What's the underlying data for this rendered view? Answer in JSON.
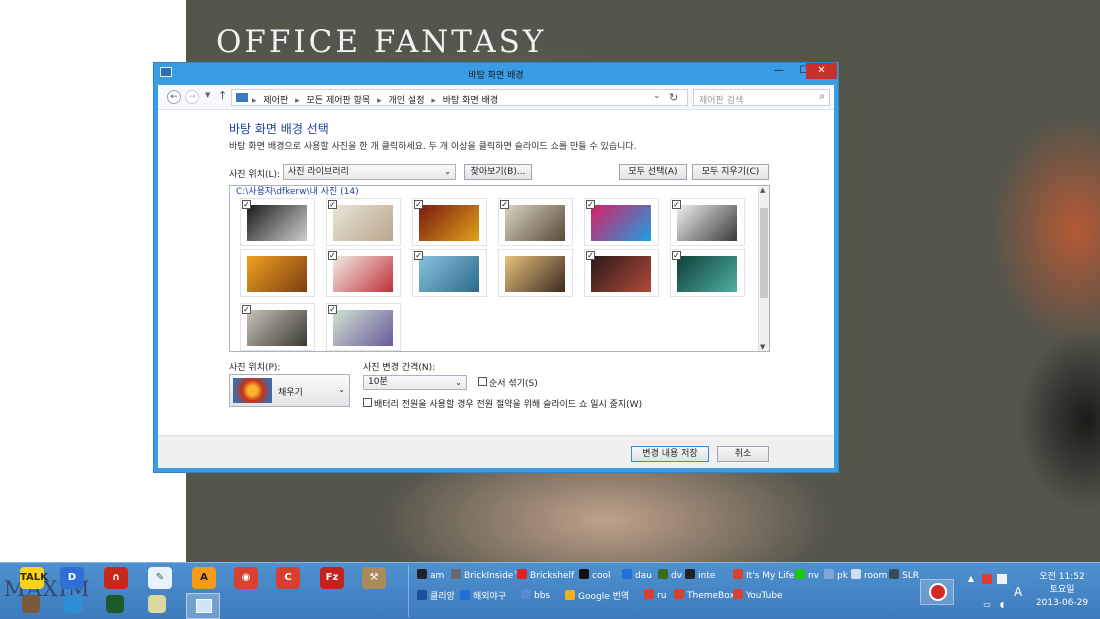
{
  "wallpaper": {
    "title": "OFFICE FANTASY"
  },
  "window": {
    "title": "바탕 화면 배경",
    "controls": {
      "minimize": "—",
      "maximize": "☐",
      "close": "✕"
    }
  },
  "address": {
    "crumbs": [
      "제어판",
      "모든 제어판 항목",
      "개인 설정",
      "바탕 화면 배경"
    ],
    "separator": "▸",
    "search_placeholder": "제어판 검색"
  },
  "page": {
    "heading": "바탕 화면 배경 선택",
    "description": "바탕 화면 배경으로 사용할 사진을 한 개 클릭하세요. 두 개 이상을 클릭하면 슬라이드 쇼를 만들 수 있습니다.",
    "location_label": "사진 위치(L):",
    "location_value": "사진 라이브러리",
    "browse": "찾아보기(B)...",
    "select_all": "모두 선택(A)",
    "clear_all": "모두 지우기(C)",
    "folder": "C:\\사용자\\dfkerw\\내 사진 (14)"
  },
  "photos": [
    {
      "checked": true,
      "colors": [
        "#1a1a1a",
        "#cfcfcf"
      ]
    },
    {
      "checked": true,
      "colors": [
        "#e9e4d8",
        "#b9a68c"
      ]
    },
    {
      "checked": true,
      "colors": [
        "#7a1a0e",
        "#e0a21d"
      ]
    },
    {
      "checked": true,
      "colors": [
        "#d9d3c2",
        "#5a4a3a"
      ]
    },
    {
      "checked": true,
      "colors": [
        "#d81e64",
        "#1ea0e0"
      ]
    },
    {
      "checked": true,
      "colors": [
        "#f0f0f0",
        "#3a3a3a"
      ]
    },
    {
      "checked": false,
      "colors": [
        "#f0a020",
        "#7b3e12"
      ]
    },
    {
      "checked": true,
      "colors": [
        "#f2ede6",
        "#c0303a"
      ]
    },
    {
      "checked": true,
      "colors": [
        "#86c3de",
        "#2c6a8a"
      ]
    },
    {
      "checked": false,
      "colors": [
        "#e7c07a",
        "#3b2c22"
      ]
    },
    {
      "checked": true,
      "colors": [
        "#2a1a18",
        "#b04a3a"
      ]
    },
    {
      "checked": true,
      "colors": [
        "#0f3f3a",
        "#4fb0a0"
      ]
    },
    {
      "checked": true,
      "colors": [
        "#c8c3b8",
        "#3a3a32"
      ]
    },
    {
      "checked": true,
      "colors": [
        "#cfe3d0",
        "#6a5a9a"
      ]
    }
  ],
  "options": {
    "position_label": "사진 위치(P):",
    "position_value": "채우기",
    "interval_label": "사진 변경 간격(N):",
    "interval_value": "10분",
    "shuffle_label": "순서 섞기(S)",
    "shuffle_checked": false,
    "battery_label": "배터리 전원을 사용할 경우 전원 절약을 위해 슬라이드 쇼 일시 중지(W)",
    "battery_checked": false
  },
  "footer": {
    "save": "변경 내용 저장",
    "cancel": "취소"
  },
  "taskbar": {
    "logo_text": "MAXIM",
    "apps": [
      {
        "name": "kakaotalk-icon",
        "label": "TALK",
        "color": "#f7d21e",
        "text": "#3a2a00"
      },
      {
        "name": "daum-icon",
        "label": "D",
        "color": "#2f6fd6",
        "text": "#fff"
      },
      {
        "name": "magnet-icon",
        "label": "∩",
        "color": "#c7281c",
        "text": "#fff"
      },
      {
        "name": "pen-icon",
        "label": "✎",
        "color": "#e8f3ff",
        "text": "#2c6a3a"
      },
      {
        "name": "avast-icon",
        "label": "A",
        "color": "#f29a1c",
        "text": "#222"
      },
      {
        "name": "chrome-icon",
        "label": "◉",
        "color": "#d9412f",
        "text": "#fff"
      },
      {
        "name": "ccleaner-icon",
        "label": "C",
        "color": "#d7402e",
        "text": "#fff"
      },
      {
        "name": "filezilla-icon",
        "label": "Fz",
        "color": "#c3221c",
        "text": "#fff"
      },
      {
        "name": "tool-icon",
        "label": "⚒",
        "color": "#a98a5a",
        "text": "#fff"
      }
    ],
    "quicklinks_row1": [
      {
        "label": "am",
        "color": "#222"
      },
      {
        "label": "BrickInside™",
        "color": "#6a6a6a"
      },
      {
        "label": "Brickshelf",
        "color": "#d22"
      },
      {
        "label": "cool",
        "color": "#111"
      },
      {
        "label": "dau",
        "color": "#1e6fd6"
      },
      {
        "label": "dv",
        "color": "#3a6a1a"
      },
      {
        "label": "inte",
        "color": "#222"
      },
      {
        "label": "It's My Life",
        "color": "#d9412f"
      },
      {
        "label": "nv",
        "color": "#1ec800"
      },
      {
        "label": "pk",
        "color": "#7fa7d7"
      },
      {
        "label": "room",
        "color": "#cfe0f0"
      },
      {
        "label": "SLR",
        "color": "#3a4a5a"
      }
    ],
    "quicklinks_row2": [
      {
        "label": "클리앙",
        "color": "#1c4f9a"
      },
      {
        "label": "해외야구",
        "color": "#1e6fd6"
      },
      {
        "label": "bbs",
        "color": "#5a8ad0"
      },
      {
        "label": "Google 번역",
        "color": "#f2b01c"
      },
      {
        "label": "ru",
        "color": "#d9412f"
      },
      {
        "label": "ThemeBox",
        "color": "#d9412f"
      },
      {
        "label": "YouTube",
        "color": "#d9412f"
      }
    ],
    "ime": "A",
    "clock": {
      "time": "오전 11:52",
      "day": "토요일",
      "date": "2013-06-29"
    }
  }
}
